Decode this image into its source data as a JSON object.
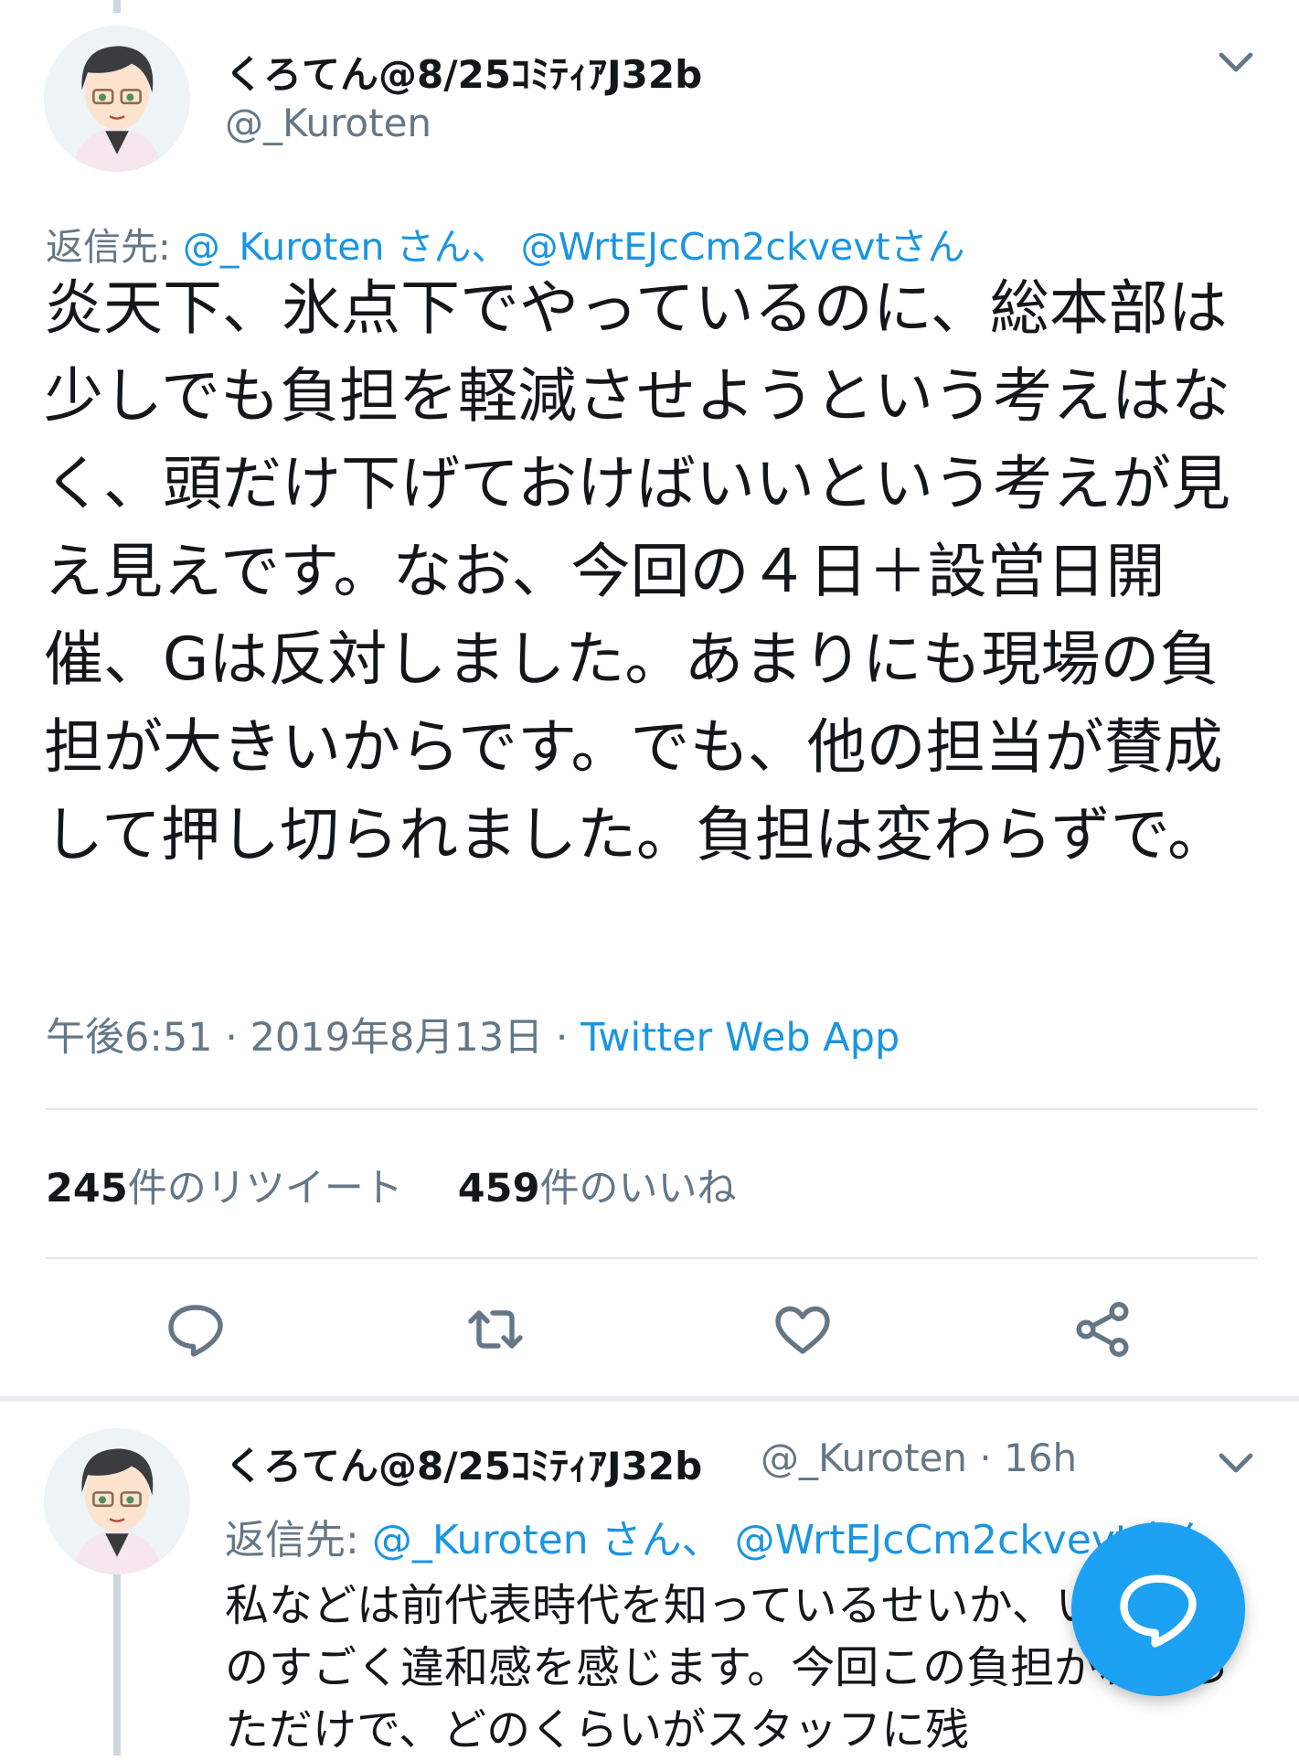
{
  "tweet": {
    "author_name": "くろてん@8/25ｺﾐﾃｨｱJ32b",
    "author_handle": "@_Kuroten",
    "reply_prefix": "返信先: ",
    "reply_mention_1": "@_Kuroten さん、",
    "reply_mention_2": "@WrtEJcCm2ckvevtさん",
    "text": "炎天下、氷点下でやっているのに、総本部は少しでも負担を軽減させようという考えはなく、頭だけ下げておけばいいという考えが見え見えです。なお、今回の４日＋設営日開催、Gは反対しました。あまりにも現場の負担が大きいからです。でも、他の担当が賛成して押し切られました。負担は変わらずで。",
    "time": "午後6:51",
    "date": "2019年8月13日",
    "source": "Twitter Web App",
    "retweet_count": "245",
    "retweet_label": "件のリツイート",
    "like_count": "459",
    "like_label": "件のいいね"
  },
  "reply": {
    "author_name": "くろてん@8/25ｺﾐﾃｨｱJ32b",
    "author_handle": "@_Kuroten",
    "age": "16h",
    "reply_prefix": "返信先: ",
    "reply_mention_1": "@_Kuroten さん、",
    "reply_mention_2": "@WrtEJcCm2ckvevtさん",
    "text": "私などは前代表時代を知っているせいか、い制にものすごく違和感を感じます。今回この負担がわかっただけで、どのくらいがスタッフに残"
  },
  "icons": {
    "caret": "chevron-down-icon",
    "reply": "reply-icon",
    "retweet": "retweet-icon",
    "like": "heart-icon",
    "share": "share-icon",
    "compose": "compose-icon"
  },
  "colors": {
    "link": "#1b95e0",
    "muted": "#657786",
    "fab": "#1da1f2",
    "divider": "#e1e8ed"
  }
}
